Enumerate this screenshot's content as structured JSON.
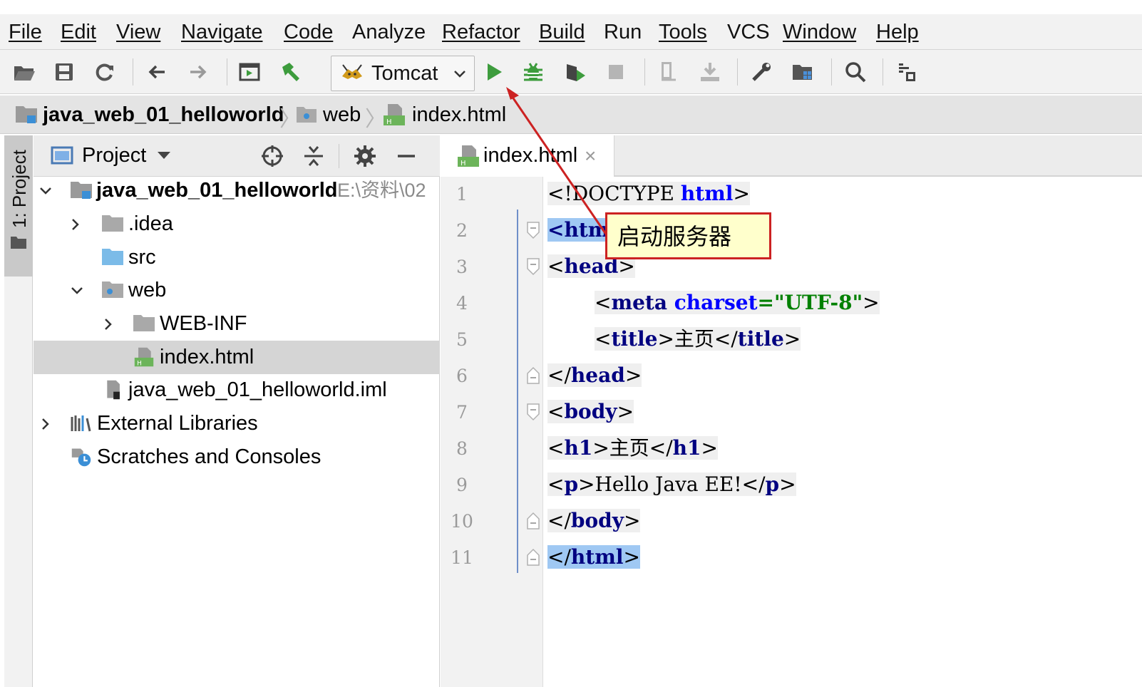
{
  "menu": {
    "items": [
      {
        "label": "File",
        "mnemonic_index": 0
      },
      {
        "label": "Edit",
        "mnemonic_index": 0
      },
      {
        "label": "View",
        "mnemonic_index": 0
      },
      {
        "label": "Navigate",
        "mnemonic_index": 0
      },
      {
        "label": "Code",
        "mnemonic_index": 0
      },
      {
        "label": "Analyze",
        "mnemonic_index": 6
      },
      {
        "label": "Refactor",
        "mnemonic_index": 0
      },
      {
        "label": "Build",
        "mnemonic_index": 0
      },
      {
        "label": "Run",
        "mnemonic_index": 1
      },
      {
        "label": "Tools",
        "mnemonic_index": 0
      },
      {
        "label": "VCS",
        "mnemonic_index": 2
      },
      {
        "label": "Window",
        "mnemonic_index": 0
      },
      {
        "label": "Help",
        "mnemonic_index": 0
      }
    ]
  },
  "toolbar": {
    "run_config": "Tomcat",
    "icons": [
      "open-folder-icon",
      "save-icon",
      "sync-icon",
      "back-icon",
      "forward-icon",
      "project-structure-icon",
      "build-hammer-icon",
      "run-icon",
      "debug-icon",
      "coverage-icon",
      "stop-icon",
      "update-icon",
      "deploy-icon",
      "settings-wrench-icon",
      "project-structure-folder-icon",
      "search-icon",
      "vcs-icon"
    ]
  },
  "breadcrumb": {
    "items": [
      "java_web_01_helloworld",
      "web",
      "index.html"
    ]
  },
  "tool_stripe": {
    "label": "1: Project"
  },
  "project_panel": {
    "title": "Project",
    "tree": [
      {
        "label": "java_web_01_helloworld",
        "path": "E:\\资料\\02",
        "bold": true
      },
      {
        "label": ".idea"
      },
      {
        "label": "src"
      },
      {
        "label": "web"
      },
      {
        "label": "WEB-INF"
      },
      {
        "label": "index.html",
        "selected": true
      },
      {
        "label": "java_web_01_helloworld.iml"
      },
      {
        "label": "External Libraries"
      },
      {
        "label": "Scratches and Consoles"
      }
    ]
  },
  "editor": {
    "tab": {
      "label": "index.html",
      "close": "×"
    },
    "line_numbers": [
      "1",
      "2",
      "3",
      "4",
      "5",
      "6",
      "7",
      "8",
      "9",
      "10",
      "11"
    ],
    "code": {
      "l1_open": "<",
      "l1_bang": "!DOCTYPE ",
      "l1_html": "html",
      "l1_close": ">",
      "l2_text": "<htm",
      "l3_open": "<",
      "l3_tag": "head",
      "l3_close": ">",
      "l4_open": "<",
      "l4_tag": "meta ",
      "l4_attr": "charset",
      "l4_eq": "=",
      "l4_val": "\"UTF-8\"",
      "l4_close": ">",
      "l5_open": "<",
      "l5_tag": "title",
      "l5_mid": ">主页</",
      "l5_tag2": "title",
      "l5_close": ">",
      "l6_open": "</",
      "l6_tag": "head",
      "l6_close": ">",
      "l7_open": "<",
      "l7_tag": "body",
      "l7_close": ">",
      "l8_open": "<",
      "l8_tag": "h1",
      "l8_mid": ">主页</",
      "l8_tag2": "h1",
      "l8_close": ">",
      "l9_open": "<",
      "l9_tag": "p",
      "l9_mid": ">Hello Java EE!</",
      "l9_tag2": "p",
      "l9_close": ">",
      "l10_open": "</",
      "l10_tag": "body",
      "l10_close": ">",
      "l11_open": "</",
      "l11_tag": "html",
      "l11_close": ">"
    }
  },
  "annotation": {
    "text": "启动服务器",
    "color": "#cc2222"
  },
  "colors": {
    "tag": "#000080",
    "attr": "#0000ff",
    "string": "#008000",
    "run_green": "#3d9c3d",
    "selection": "#9fc8f3",
    "current_line": "#fffae3"
  }
}
